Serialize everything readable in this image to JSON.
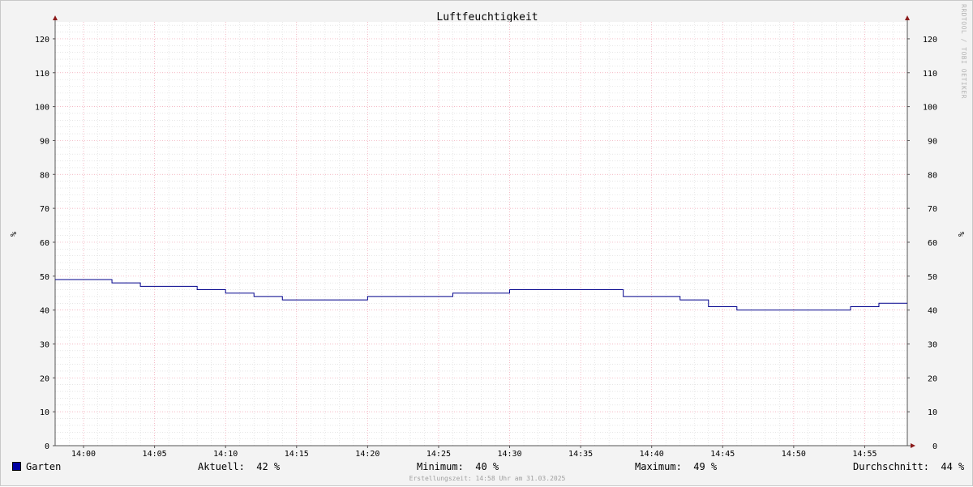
{
  "chart_data": {
    "type": "line",
    "title": "Luftfeuchtigkeit",
    "ylabel": "%",
    "ylim": [
      0,
      125
    ],
    "y_ticks": [
      0,
      10,
      20,
      30,
      40,
      50,
      60,
      70,
      80,
      90,
      100,
      110,
      120
    ],
    "x_range": [
      "13:58",
      "14:58"
    ],
    "x_ticks": [
      "14:00",
      "14:05",
      "14:10",
      "14:15",
      "14:20",
      "14:25",
      "14:30",
      "14:35",
      "14:40",
      "14:45",
      "14:50",
      "14:55"
    ],
    "grid": true,
    "series": [
      {
        "name": "Garten",
        "color": "#00008b",
        "x": [
          "13:58",
          "14:02",
          "14:04",
          "14:08",
          "14:10",
          "14:12",
          "14:14",
          "14:20",
          "14:26",
          "14:30",
          "14:38",
          "14:42",
          "14:44",
          "14:46",
          "14:54",
          "14:56",
          "14:58"
        ],
        "y": [
          49,
          48,
          47,
          46,
          45,
          44,
          43,
          44,
          45,
          46,
          44,
          43,
          41,
          40,
          41,
          42,
          42
        ]
      }
    ]
  },
  "legend": {
    "series_name": "Garten",
    "current": "Aktuell:  42 %",
    "minimum": "Minimum:  40 %",
    "maximum": "Maximum:  49 %",
    "average": "Durchschnitt:  44 %"
  },
  "footer": "Erstellungszeit: 14:58 Uhr am 31.03.2025",
  "watermark": "RRDTOOL / TOBI OETIKER"
}
